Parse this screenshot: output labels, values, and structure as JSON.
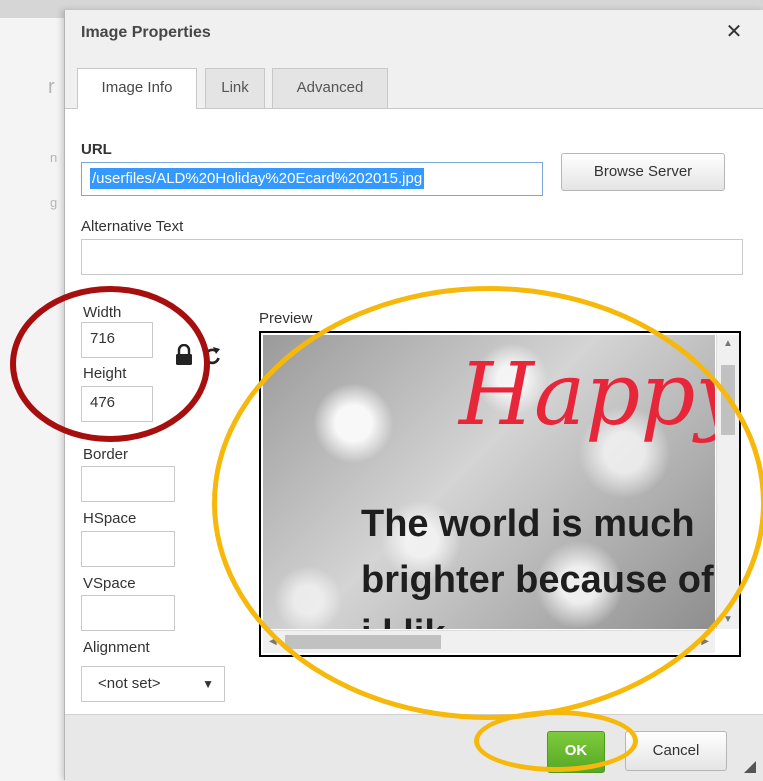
{
  "dialog": {
    "title": "Image Properties",
    "close_glyph": "✕"
  },
  "tabs": [
    {
      "label": "Image Info",
      "active": true
    },
    {
      "label": "Link",
      "active": false
    },
    {
      "label": "Advanced",
      "active": false
    }
  ],
  "url": {
    "label": "URL",
    "value": "/userfiles/ALD%20Holiday%20Ecard%202015.jpg"
  },
  "browse_server": {
    "label": "Browse Server"
  },
  "alt_text": {
    "label": "Alternative Text",
    "value": ""
  },
  "width": {
    "label": "Width",
    "value": "716"
  },
  "height": {
    "label": "Height",
    "value": "476"
  },
  "border": {
    "label": "Border",
    "value": ""
  },
  "hspace": {
    "label": "HSpace",
    "value": ""
  },
  "vspace": {
    "label": "VSpace",
    "value": ""
  },
  "alignment": {
    "label": "Alignment",
    "value": "<not set>"
  },
  "preview": {
    "label": "Preview",
    "image_text": {
      "line0": "Happy",
      "line1": "The world is much",
      "line2": "brighter because of",
      "line3": "i    l lik"
    }
  },
  "footer": {
    "ok_label": "OK",
    "cancel_label": "Cancel"
  },
  "icons": {
    "lock": "lock-icon",
    "reset": "reset-size-icon",
    "resize": "resize-handle-icon"
  },
  "colors": {
    "ok_green": "#5cb32e",
    "annotation_red": "#a70f0f",
    "annotation_yellow": "#f6b80b",
    "happy_red": "#e8263a"
  }
}
